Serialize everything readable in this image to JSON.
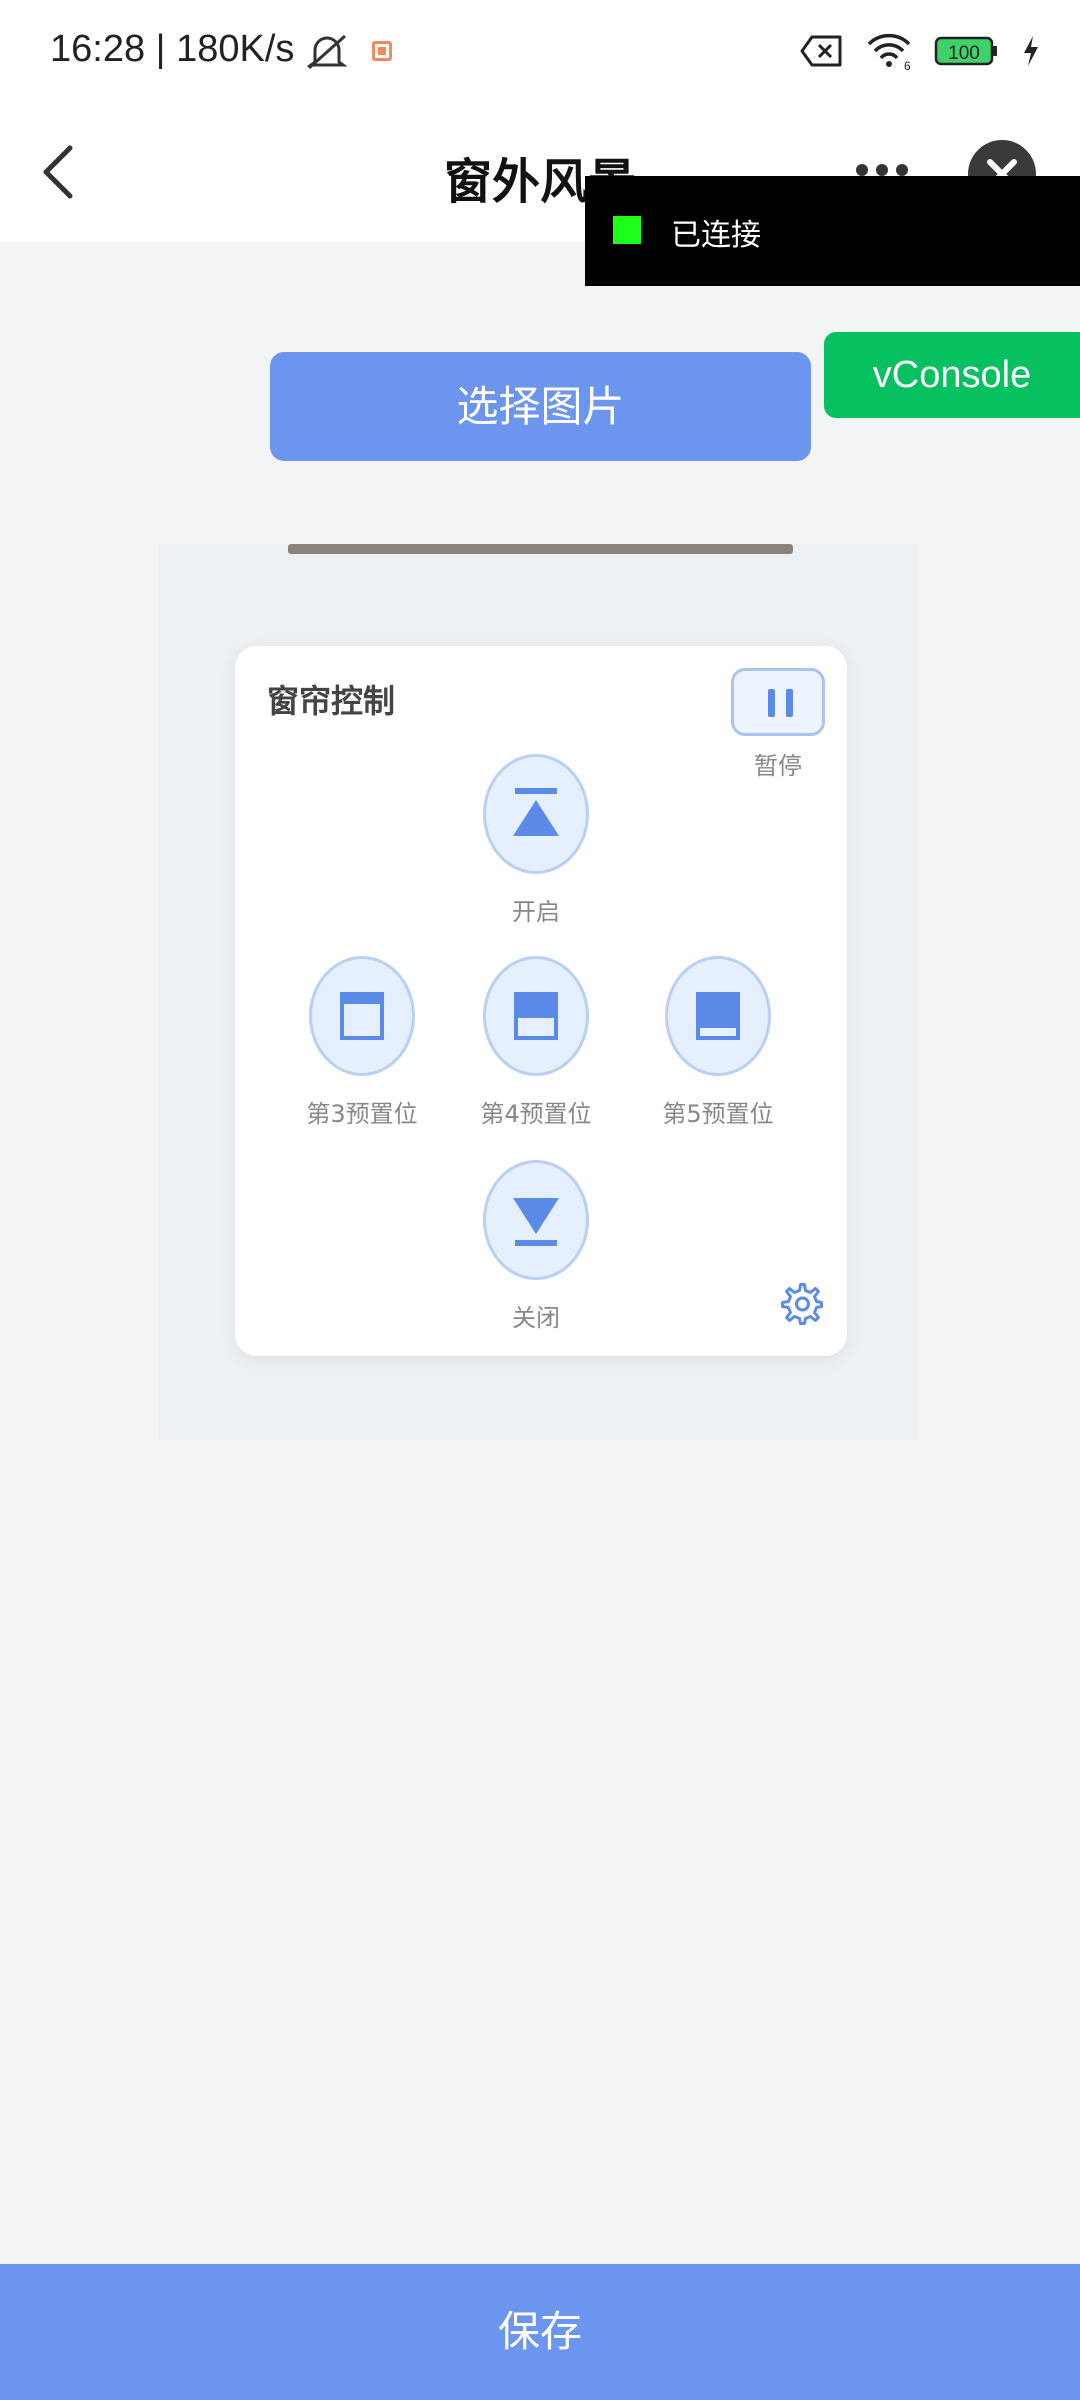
{
  "status": {
    "time": "16:28",
    "speed": "180K/s",
    "battery": "100"
  },
  "nav": {
    "title": "窗外风景"
  },
  "vconsole": {
    "log_text": "已连接",
    "button_label": "vConsole"
  },
  "actions": {
    "choose_image": "选择图片",
    "save": "保存"
  },
  "card": {
    "title": "窗帘控制",
    "pause": "暂停",
    "open": "开启",
    "preset3": "第3预置位",
    "preset4": "第4预置位",
    "preset5": "第5预置位",
    "close": "关闭"
  },
  "colors": {
    "accent": "#6b95ef",
    "vconsole_green": "#07c160",
    "connected_green": "#1bff1b"
  },
  "icons": [
    "back-arrow-icon",
    "more-icon",
    "close-icon",
    "pause-icon",
    "open-icon",
    "preset3-icon",
    "preset4-icon",
    "preset5-icon",
    "close-curtain-icon",
    "gear-icon",
    "wifi-icon",
    "battery-icon",
    "bell-off-icon",
    "sim-off-icon",
    "charging-icon"
  ]
}
